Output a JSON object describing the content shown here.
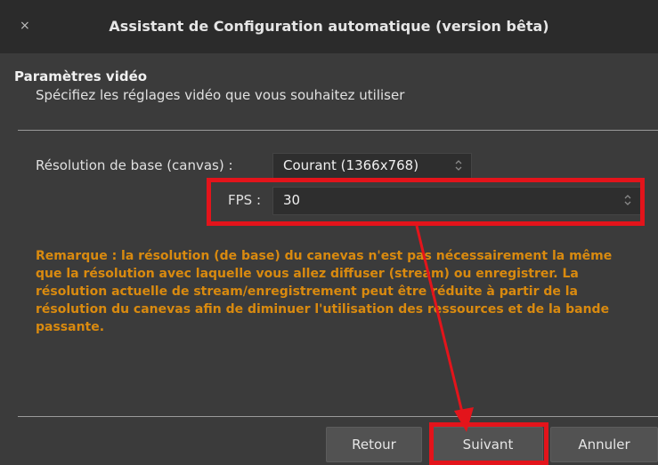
{
  "window": {
    "title": "Assistant de Configuration automatique (version bêta)",
    "close_glyph": "×"
  },
  "section": {
    "title": "Paramètres vidéo",
    "subtitle": "Spécifiez les réglages vidéo que vous souhaitez utiliser"
  },
  "fields": {
    "base_resolution_label": "Résolution de base (canvas) :",
    "base_resolution_value": "Courant (1366x768)",
    "fps_label": "FPS :",
    "fps_value": "30"
  },
  "note": "Remarque : la résolution (de base) du canevas n'est pas nécessairement la même que la résolution avec laquelle vous allez diffuser (stream) ou enregistrer. La résolution actuelle de stream/enregistrement peut être réduite à partir de la résolution du canevas afin de diminuer  l'utilisation des ressources et de la bande passante.",
  "buttons": {
    "back": "Retour",
    "next": "Suivant",
    "cancel": "Annuler"
  },
  "colors": {
    "annotation": "#e3141b",
    "note_text": "#d98a0f"
  },
  "icons": {
    "spinner": "updown-chevron-icon"
  }
}
